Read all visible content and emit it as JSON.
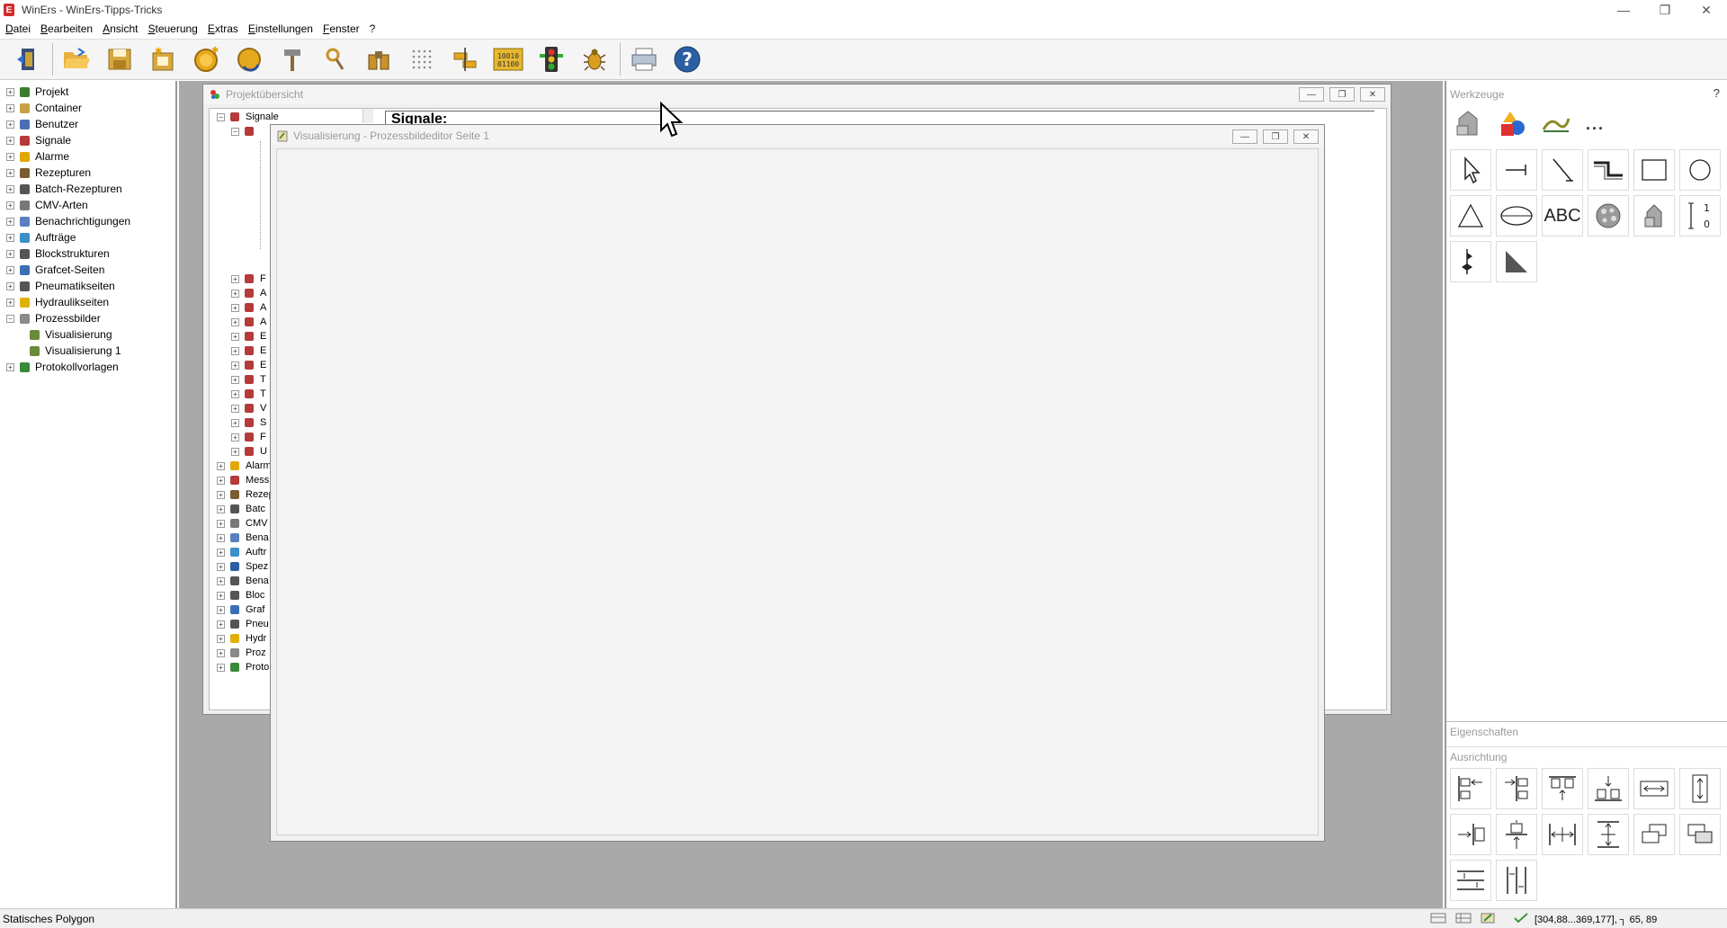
{
  "window": {
    "title": "WinErs - WinErs-Tipps-Tricks",
    "app_icon_letter": "E"
  },
  "menu": [
    "Datei",
    "Bearbeiten",
    "Ansicht",
    "Steuerung",
    "Extras",
    "Einstellungen",
    "Fenster",
    "?"
  ],
  "toolbar": {
    "items": [
      "exit-icon",
      "open-folder-icon",
      "save-icon",
      "new-project-icon",
      "signal-bulb-icon",
      "refresh-bulb-icon",
      "hammer-icon",
      "search-icon",
      "binoculars-icon",
      "grid-icon",
      "align-icon",
      "binary-icon",
      "traffic-light-icon",
      "bug-icon",
      "print-icon",
      "help-icon"
    ],
    "binary_text_top": "10010",
    "binary_text_bottom": "01100",
    "help_glyph": "?"
  },
  "tree": {
    "items": [
      {
        "label": "Projekt",
        "icon": "project-icon",
        "color": "#3a7d2c"
      },
      {
        "label": "Container",
        "icon": "container-icon",
        "color": "#c8a046"
      },
      {
        "label": "Benutzer",
        "icon": "user-icon",
        "color": "#4a6fb5"
      },
      {
        "label": "Signale",
        "icon": "signal-icon",
        "color": "#b53a3a"
      },
      {
        "label": "Alarme",
        "icon": "alarm-icon",
        "color": "#e0a800"
      },
      {
        "label": "Rezepturen",
        "icon": "recipe-icon",
        "color": "#7a5c2e"
      },
      {
        "label": "Batch-Rezepturen",
        "icon": "batch-icon",
        "color": "#555555"
      },
      {
        "label": "CMV-Arten",
        "icon": "cmv-icon",
        "color": "#777777"
      },
      {
        "label": "Benachrichtigungen",
        "icon": "notification-icon",
        "color": "#5a7fc0"
      },
      {
        "label": "Aufträge",
        "icon": "order-icon",
        "color": "#3c8fc9"
      },
      {
        "label": "Blockstrukturen",
        "icon": "block-icon",
        "color": "#555555"
      },
      {
        "label": "Grafcet-Seiten",
        "icon": "grafcet-icon",
        "color": "#3a6fb5"
      },
      {
        "label": "Pneumatikseiten",
        "icon": "pneumatic-icon",
        "color": "#555555"
      },
      {
        "label": "Hydraulikseiten",
        "icon": "hydraulic-icon",
        "color": "#e0b000"
      },
      {
        "label": "Prozessbilder",
        "icon": "process-image-icon",
        "color": "#8a8a8a"
      },
      {
        "label": "Visualisierung",
        "icon": "visualization-icon",
        "color": "#6a8a3a",
        "child": true
      },
      {
        "label": "Visualisierung 1",
        "icon": "visualization-icon",
        "color": "#6a8a3a",
        "child": true
      },
      {
        "label": "Protokollvorlagen",
        "icon": "protocol-icon",
        "color": "#3a8a3a"
      }
    ]
  },
  "projektuebersicht": {
    "title": "Projektübersicht",
    "root_label": "Signale",
    "heading": "Signale:",
    "subtree_letters": [
      "F",
      "A",
      "A",
      "A",
      "E",
      "E",
      "E",
      "T",
      "T",
      "V",
      "S",
      "F",
      "U"
    ],
    "bottom_items": [
      "Alarm",
      "Mess",
      "Rezep",
      "Batc",
      "CMV",
      "Bena",
      "Auftr",
      "Spez",
      "Bena",
      "Bloc",
      "Graf",
      "Pneu",
      "Hydr",
      "Proz",
      "Proto"
    ]
  },
  "editor": {
    "title": "Visualisierung - Prozessbildeditor Seite 1"
  },
  "werkzeuge": {
    "header": "Werkzeuge",
    "help": "?",
    "top_row": [
      "shapes-icon",
      "colored-shapes-icon",
      "draw-icon",
      "more-icon"
    ],
    "more_text": "...",
    "tools": [
      "pointer-icon",
      "line-tool-icon",
      "diagonal-line-icon",
      "polyline-icon",
      "rectangle-icon",
      "circle-icon",
      "triangle-icon",
      "ellipse-icon",
      "text-tool-icon",
      "picture-icon",
      "object-icon",
      "bit-display-icon",
      "signal-tool-icon",
      "angle-icon"
    ],
    "text_tool_label": "ABC",
    "bit_top": "1",
    "bit_bottom": "0"
  },
  "eigenschaften": {
    "header": "Eigenschaften"
  },
  "ausrichtung": {
    "header": "Ausrichtung",
    "buttons": [
      "align-left-icon",
      "align-center-h-icon",
      "align-top-icon",
      "align-bottom-icon",
      "same-width-icon",
      "same-height-icon",
      "center-horizontal-icon",
      "center-vertical-icon",
      "distribute-horizontal-icon",
      "distribute-vertical-icon",
      "bring-front-icon",
      "send-back-icon",
      "space-horizontal-icon",
      "space-vertical-icon"
    ]
  },
  "status": {
    "left": "Statisches Polygon",
    "coords": "[304,88...369,177], ┐ 65, 89"
  }
}
